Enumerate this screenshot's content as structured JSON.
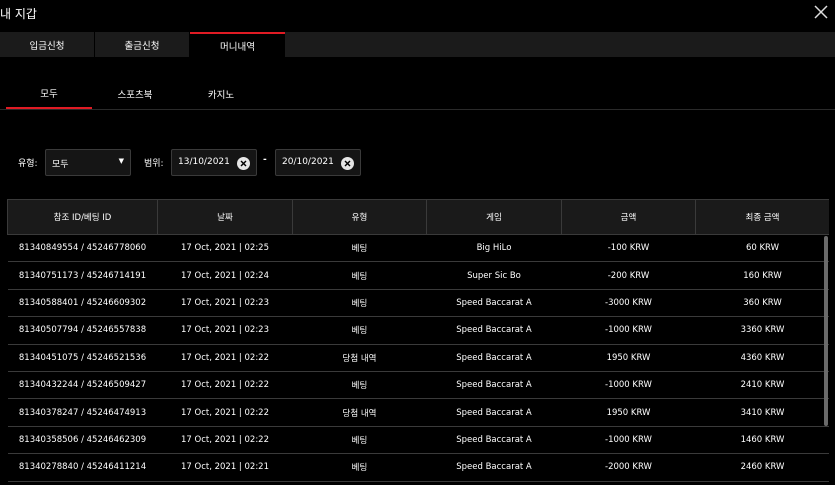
{
  "window": {
    "title": "내 지갑"
  },
  "main_tabs": [
    {
      "label": "입금신청"
    },
    {
      "label": "출금신청"
    },
    {
      "label": "머니내역"
    }
  ],
  "sub_tabs": [
    {
      "label": "모두"
    },
    {
      "label": "스포츠북"
    },
    {
      "label": "카지노"
    }
  ],
  "filters": {
    "type_label": "유형:",
    "type_value": "모두",
    "range_label": "범위:",
    "date_from": "13/10/2021",
    "separator": "-",
    "date_to": "20/10/2021"
  },
  "table": {
    "headers": [
      "참조 ID/베팅 ID",
      "날짜",
      "유형",
      "게임",
      "금액",
      "최종 금액"
    ],
    "rows": [
      [
        "81340849554 / 45246778060",
        "17 Oct, 2021 | 02:25",
        "베팅",
        "Big HiLo",
        "-100 KRW",
        "60 KRW"
      ],
      [
        "81340751173 / 45246714191",
        "17 Oct, 2021 | 02:24",
        "베팅",
        "Super Sic Bo",
        "-200 KRW",
        "160 KRW"
      ],
      [
        "81340588401 / 45246609302",
        "17 Oct, 2021 | 02:23",
        "베팅",
        "Speed Baccarat A",
        "-3000 KRW",
        "360 KRW"
      ],
      [
        "81340507794 / 45246557838",
        "17 Oct, 2021 | 02:23",
        "베팅",
        "Speed Baccarat A",
        "-1000 KRW",
        "3360 KRW"
      ],
      [
        "81340451075 / 45246521536",
        "17 Oct, 2021 | 02:22",
        "당첨 내역",
        "Speed Baccarat A",
        "1950 KRW",
        "4360 KRW"
      ],
      [
        "81340432244 / 45246509427",
        "17 Oct, 2021 | 02:22",
        "베팅",
        "Speed Baccarat A",
        "-1000 KRW",
        "2410 KRW"
      ],
      [
        "81340378247 / 45246474913",
        "17 Oct, 2021 | 02:22",
        "당첨 내역",
        "Speed Baccarat A",
        "1950 KRW",
        "3410 KRW"
      ],
      [
        "81340358506 / 45246462309",
        "17 Oct, 2021 | 02:22",
        "베팅",
        "Speed Baccarat A",
        "-1000 KRW",
        "1460 KRW"
      ],
      [
        "81340278840 / 45246411214",
        "17 Oct, 2021 | 02:21",
        "베팅",
        "Speed Baccarat A",
        "-2000 KRW",
        "2460 KRW"
      ]
    ]
  },
  "icons": {
    "close": "close-icon",
    "caret": "caret-down-icon",
    "clear": "clear-icon"
  },
  "colors": {
    "accent": "#e01b24",
    "background": "#000000",
    "tab_bg": "#1b1b1b"
  }
}
